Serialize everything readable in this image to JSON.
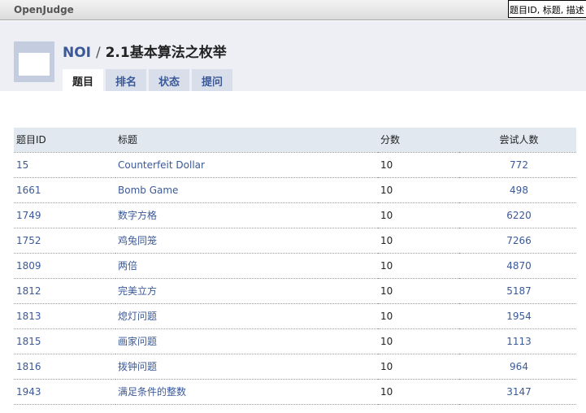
{
  "topbar": {
    "logo": "OpenJudge",
    "search_value": "题目ID, 标题, 描述"
  },
  "header": {
    "org": "NOI",
    "separator": "/",
    "group": "2.1基本算法之枚举"
  },
  "tabs": [
    "题目",
    "排名",
    "状态",
    "提问"
  ],
  "table": {
    "columns": [
      "题目ID",
      "标题",
      "分数",
      "尝试人数"
    ],
    "rows": [
      [
        "15",
        "Counterfeit Dollar",
        "10",
        "772"
      ],
      [
        "1661",
        "Bomb Game",
        "10",
        "498"
      ],
      [
        "1749",
        "数字方格",
        "10",
        "6220"
      ],
      [
        "1752",
        "鸡兔同笼",
        "10",
        "7266"
      ],
      [
        "1809",
        "两倍",
        "10",
        "4870"
      ],
      [
        "1812",
        "完美立方",
        "10",
        "5187"
      ],
      [
        "1813",
        "熄灯问题",
        "10",
        "1954"
      ],
      [
        "1815",
        "画家问题",
        "10",
        "1113"
      ],
      [
        "1816",
        "拨钟问题",
        "10",
        "964"
      ],
      [
        "1943",
        "满足条件的整数",
        "10",
        "3147"
      ]
    ]
  }
}
